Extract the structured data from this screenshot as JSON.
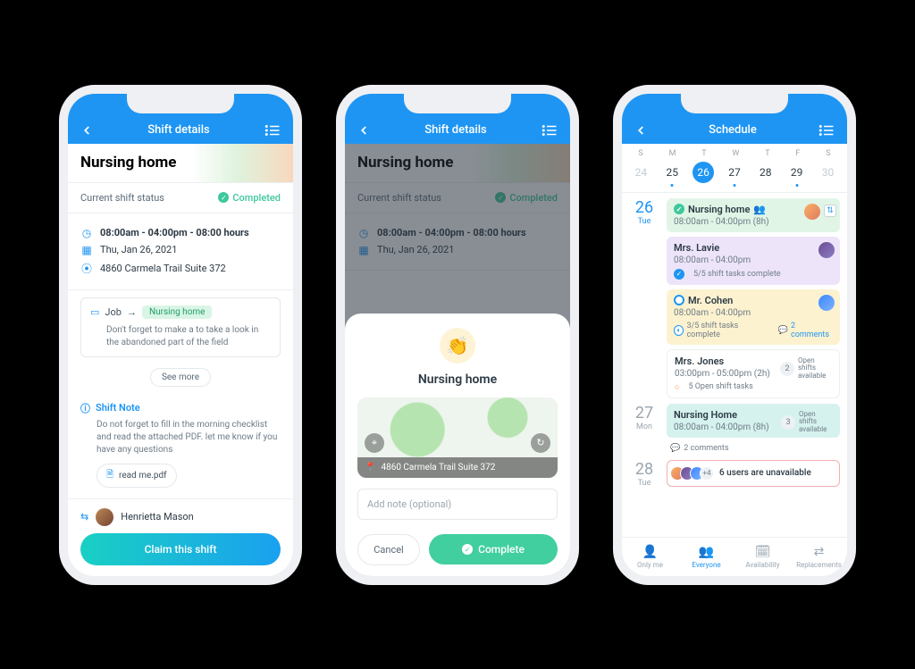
{
  "colors": {
    "primary": "#1e95f3",
    "success_bg": "#3ec89d",
    "cta_grad_a": "#19d0c3",
    "cta_grad_b": "#1aa0f0",
    "complete_btn": "#41cf9f"
  },
  "phone1": {
    "header_title": "Shift details",
    "hero_title": "Nursing home",
    "status_label": "Current shift status",
    "status_value": "Completed",
    "time": "08:00am - 04:00pm - 08:00 hours",
    "date": "Thu, Jan 26, 2021",
    "address": "4860 Carmela Trail Suite 372",
    "job_label": "Job",
    "job_arrow": "→",
    "job_value": "Nursing home",
    "job_note": "Don't forget to make a to take a look in the abandoned part of the field",
    "see_more": "See more",
    "shift_note_label": "Shift Note",
    "shift_note_text": "Do not forget to fill in the morning checklist and read the attached PDF. let me know if you have any questions",
    "attachment": "read me.pdf",
    "user": "Henrietta Mason",
    "cta": "Claim this shift"
  },
  "phone2": {
    "header_title": "Shift details",
    "hero_title": "Nursing home",
    "status_label": "Current shift status",
    "status_value": "Completed",
    "time": "08:00am - 04:00pm - 08:00 hours",
    "date": "Thu, Jan 26, 2021",
    "sheet_title": "Nursing home",
    "map_address": "4860 Carmela Trail Suite 372",
    "note_placeholder": "Add note (optional)",
    "cancel": "Cancel",
    "complete": "Complete"
  },
  "phone3": {
    "header_title": "Schedule",
    "weekdays": [
      "S",
      "M",
      "T",
      "W",
      "T",
      "F",
      "S"
    ],
    "days": [
      "24",
      "25",
      "26",
      "27",
      "28",
      "29",
      "30"
    ],
    "selected_index": 2,
    "d26": {
      "num": "26",
      "name": "Tue",
      "card1": {
        "title": "Nursing home",
        "time": "08:00am - 04:00pm (8h)"
      },
      "card2": {
        "title": "Mrs. Lavie",
        "time": "08:00am - 04:00pm",
        "tasks": "5/5 shift tasks complete"
      },
      "card3": {
        "title": "Mr. Cohen",
        "time": "08:00am - 04:00pm",
        "tasks": "3/5 shift tasks complete",
        "comments": "2 comments"
      },
      "card4": {
        "title": "Mrs. Jones",
        "time": "03:00pm - 05:00pm (2h)",
        "tasks": "5 Open shift tasks",
        "open_n": "2",
        "open_txt": "Open shifts available"
      }
    },
    "d27": {
      "num": "27",
      "name": "Mon",
      "card1": {
        "title": "Nursing Home",
        "time": "08:00am - 04:00pm (8h)",
        "open_n": "3",
        "open_txt": "Open shifts available",
        "comments": "2 comments"
      }
    },
    "d28": {
      "num": "28",
      "name": "Tue",
      "card1": {
        "plus": "+4",
        "text": "6 users are unavailable"
      }
    },
    "nav": {
      "a": "Only me",
      "b": "Everyone",
      "c": "Availability",
      "d": "Replacements"
    }
  }
}
